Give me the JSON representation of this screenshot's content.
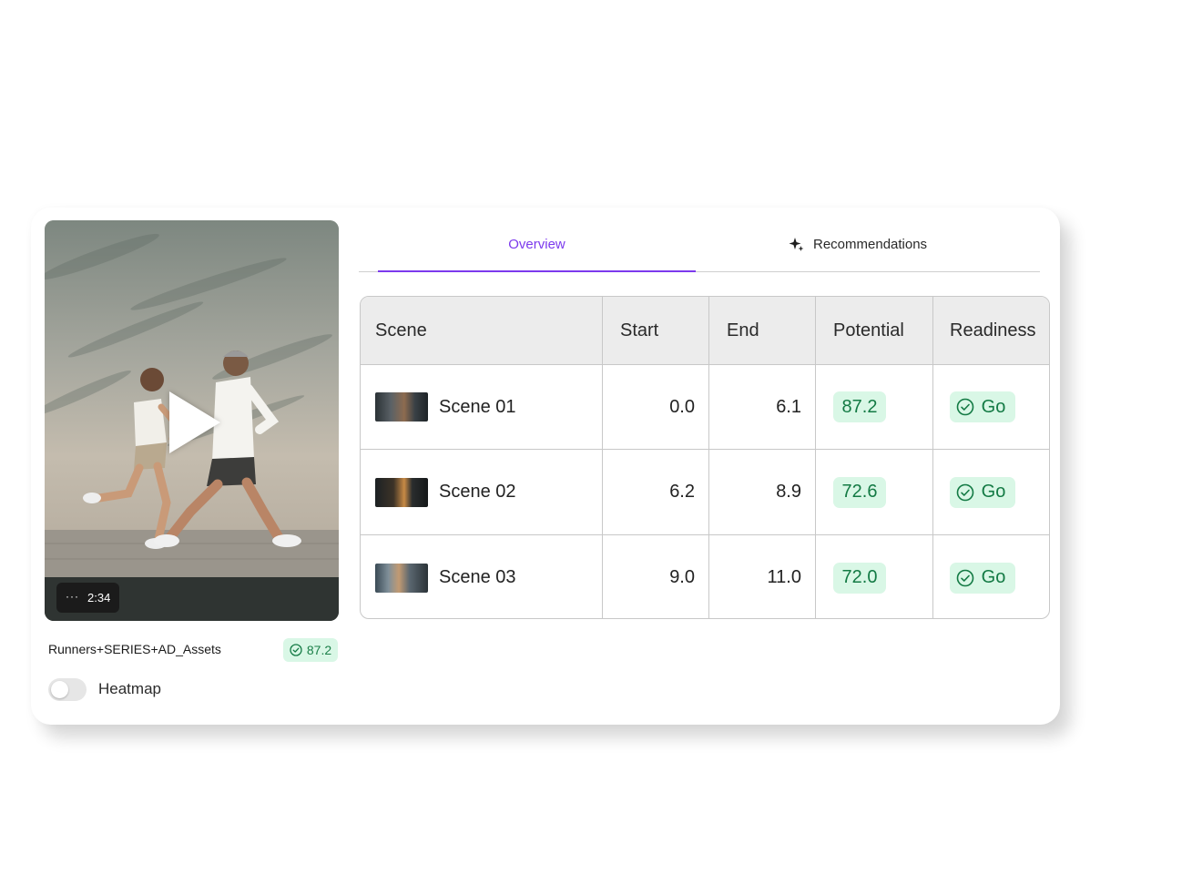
{
  "player": {
    "duration": "2:34",
    "more_label": "···",
    "asset_name": "Runners+SERIES+AD_Assets",
    "asset_score": "87.2",
    "play_icon": "play-icon"
  },
  "heatmap": {
    "label": "Heatmap",
    "enabled": false
  },
  "tabs": [
    {
      "label": "Overview",
      "active": true
    },
    {
      "label": "Recommendations",
      "active": false,
      "icon": "sparkle-icon"
    }
  ],
  "table": {
    "headers": [
      "Scene",
      "Start",
      "End",
      "Potential",
      "Readiness"
    ],
    "rows": [
      {
        "scene": "Scene 01",
        "start": "0.0",
        "end": "6.1",
        "potential": "87.2",
        "readiness": "Go"
      },
      {
        "scene": "Scene 02",
        "start": "6.2",
        "end": "8.9",
        "potential": "72.6",
        "readiness": "Go"
      },
      {
        "scene": "Scene 03",
        "start": "9.0",
        "end": "11.0",
        "potential": "72.0",
        "readiness": "Go"
      }
    ]
  },
  "colors": {
    "accent": "#7c3aed",
    "score_bg": "#d9f7e6",
    "score_text": "#137a44"
  }
}
